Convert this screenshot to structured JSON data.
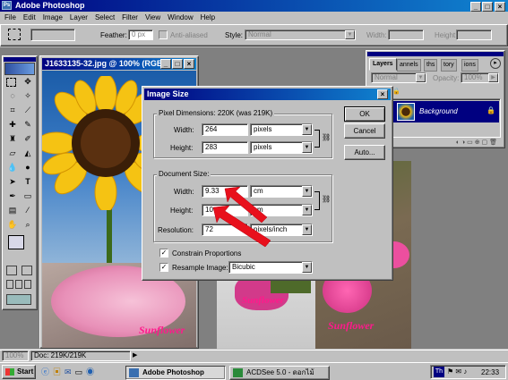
{
  "app": {
    "title": "Adobe Photoshop"
  },
  "menu": [
    "File",
    "Edit",
    "Image",
    "Layer",
    "Select",
    "Filter",
    "View",
    "Window",
    "Help"
  ],
  "options_bar": {
    "feather_label": "Feather:",
    "feather_value": "0 px",
    "antialias_label": "Anti-aliased",
    "style_label": "Style:",
    "style_value": "Normal",
    "width_label": "Width:",
    "height_label": "Height:"
  },
  "doc_window": {
    "title": "J1633135-32.jpg @ 100% (RGB)"
  },
  "image_captions": {
    "caption1": "Sunflower",
    "caption2": "Sunflower",
    "caption3": "Sunflower"
  },
  "dialog": {
    "title": "Image Size",
    "pixel_dimensions": {
      "label": "Pixel Dimensions:",
      "value": "220K (was 219K)"
    },
    "pixel_width": {
      "label": "Width:",
      "value": "264",
      "unit": "pixels"
    },
    "pixel_height": {
      "label": "Height:",
      "value": "283",
      "unit": "pixels"
    },
    "document_size": {
      "label": "Document Size:"
    },
    "doc_width": {
      "label": "Width:",
      "value": "9.33",
      "unit": "cm"
    },
    "doc_height": {
      "label": "Height:",
      "value": "10",
      "unit": "cm"
    },
    "resolution": {
      "label": "Resolution:",
      "value": "72",
      "unit": "pixels/inch"
    },
    "constrain": {
      "label": "Constrain Proportions",
      "checked": true
    },
    "resample": {
      "label": "Resample Image:",
      "checked": true,
      "method": "Bicubic"
    },
    "buttons": {
      "ok": "OK",
      "cancel": "Cancel",
      "auto": "Auto..."
    }
  },
  "layers_panel": {
    "tabs": [
      "Layers",
      "annels",
      "ths",
      "tory",
      "ions"
    ],
    "blend_mode": "Normal",
    "opacity_label": "Opacity:",
    "opacity_value": "100%",
    "layer_name": "Background"
  },
  "status_bar": {
    "zoom": "100%",
    "doc_info": "Doc: 219K/219K"
  },
  "taskbar": {
    "start": "Start",
    "items": [
      "Adobe Photoshop",
      "ACDSee 5.0 - ดอกไม้"
    ],
    "tray_lang": "Th",
    "clock": "22:33"
  },
  "colors": {
    "title_blue": "#000080",
    "arrow_red": "#e8101c",
    "caption_pink": "#ff1a8c"
  }
}
